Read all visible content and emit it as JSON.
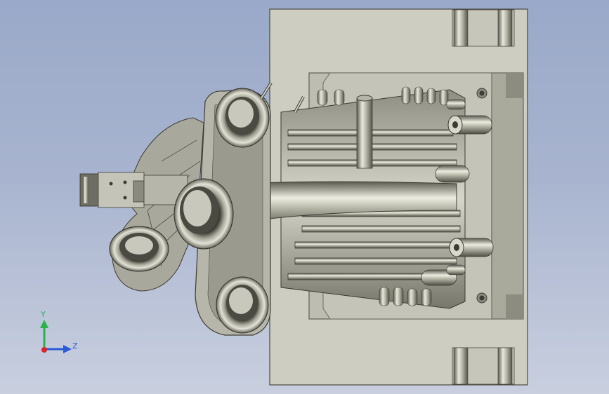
{
  "viewport": {
    "background_top": "#9aa9c9",
    "background_bottom": "#c9cfdf",
    "model": "die-casting-mold-assembly"
  },
  "triad": {
    "y_label": "Y",
    "z_label": "Z",
    "y_color": "#2bb24c",
    "z_color": "#2a5ad8",
    "x_color": "#d8262a"
  },
  "colors": {
    "plate": "#cfcfc2",
    "plate_edge": "#505046",
    "metal_dark": "#6e6e64",
    "metal_mid": "#a8a89a",
    "metal_light": "#e6e6da"
  }
}
